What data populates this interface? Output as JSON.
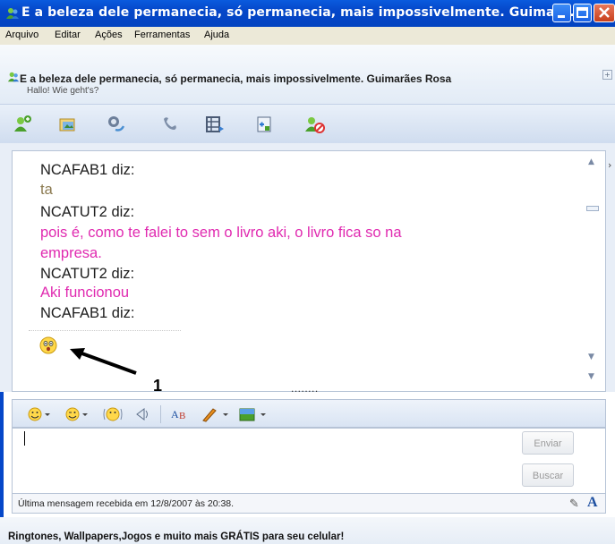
{
  "window": {
    "title": "E a beleza dele permanecia, só permanecia, mais impossivelmente. Guimarã..."
  },
  "menu": [
    {
      "label": "Arquivo"
    },
    {
      "label": "Editar"
    },
    {
      "label": "Ações"
    },
    {
      "label": "Ferramentas"
    },
    {
      "label": "Ajuda"
    }
  ],
  "contact": {
    "name": "E a beleza dele permanecia, só permanecia, mais impossivelmente. Guimarães Rosa",
    "status": "Hallo! Wie geht's?"
  },
  "toolbar_icons": [
    "invite-contact-icon",
    "send-files-icon",
    "video-call-icon",
    "voice-call-icon",
    "activities-icon",
    "games-icon",
    "block-contact-icon"
  ],
  "conversation": [
    {
      "text": "NCAFAB1 diz:",
      "kind": "nick"
    },
    {
      "text": "ta",
      "kind": "msg-olive"
    },
    {
      "text": "NCATUT2 diz:",
      "kind": "nick"
    },
    {
      "text": "pois é, como te falei to sem o livro aki, o livro fica so na",
      "kind": "msg-pink"
    },
    {
      "text": "empresa.",
      "kind": "msg-pink"
    },
    {
      "text": "NCATUT2 diz:",
      "kind": "nick"
    },
    {
      "text": "Aki funcionou",
      "kind": "msg-pink"
    },
    {
      "text": "NCAFAB1 diz:",
      "kind": "nick"
    }
  ],
  "annotation": {
    "label": "1"
  },
  "grip": "........",
  "format_toolbar_icons": [
    "emoticon-icon",
    "wink-icon",
    "animated-emoticon-icon",
    "nudge-icon",
    "font-icon",
    "pen-color-icon",
    "background-icon"
  ],
  "buttons": {
    "send": "Enviar",
    "search": "Buscar"
  },
  "status": {
    "last_message": "Última mensagem recebida em 12/8/2007 às 20:38."
  },
  "ad": {
    "text": "Ringtones, Wallpapers,Jogos e muito mais GRÁTIS para seu celular!"
  },
  "colors": {
    "titlebar": "#0547c9",
    "msg_pink": "#e02ab0",
    "msg_olive": "#8b7a50"
  }
}
